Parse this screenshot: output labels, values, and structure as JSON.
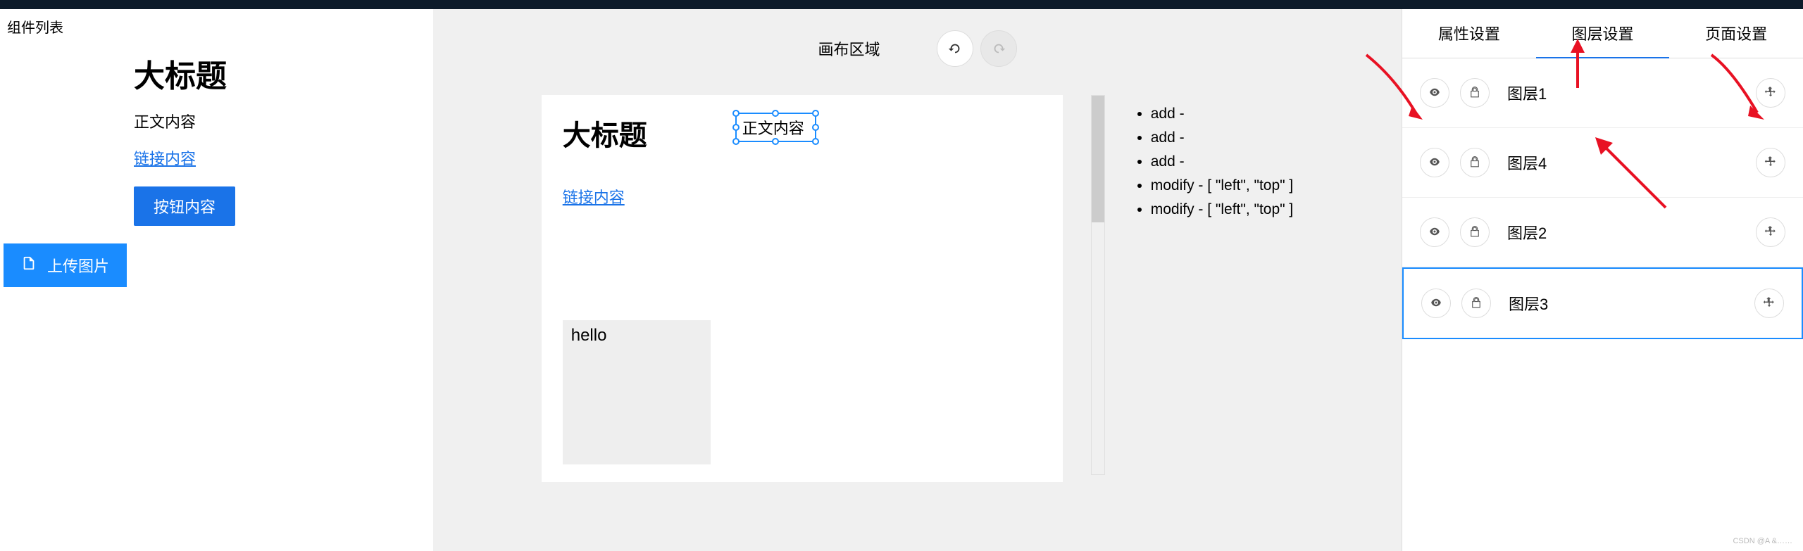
{
  "sidebar": {
    "title": "组件列表",
    "heading": "大标题",
    "text": "正文内容",
    "link": "链接内容",
    "button": "按钮内容",
    "upload": "上传图片"
  },
  "canvas": {
    "title": "画布区域",
    "heading": "大标题",
    "selected_text": "正文内容",
    "link": "链接内容",
    "hello": "hello"
  },
  "events": [
    "add -",
    "add -",
    "add -",
    "modify - [ \"left\", \"top\" ]",
    "modify - [ \"left\", \"top\" ]"
  ],
  "panel": {
    "tabs": [
      "属性设置",
      "图层设置",
      "页面设置"
    ],
    "active_tab": 1,
    "layers": [
      {
        "name": "图层1",
        "selected": false
      },
      {
        "name": "图层4",
        "selected": false
      },
      {
        "name": "图层2",
        "selected": false
      },
      {
        "name": "图层3",
        "selected": true
      }
    ]
  },
  "watermark": "CSDN @A &……"
}
